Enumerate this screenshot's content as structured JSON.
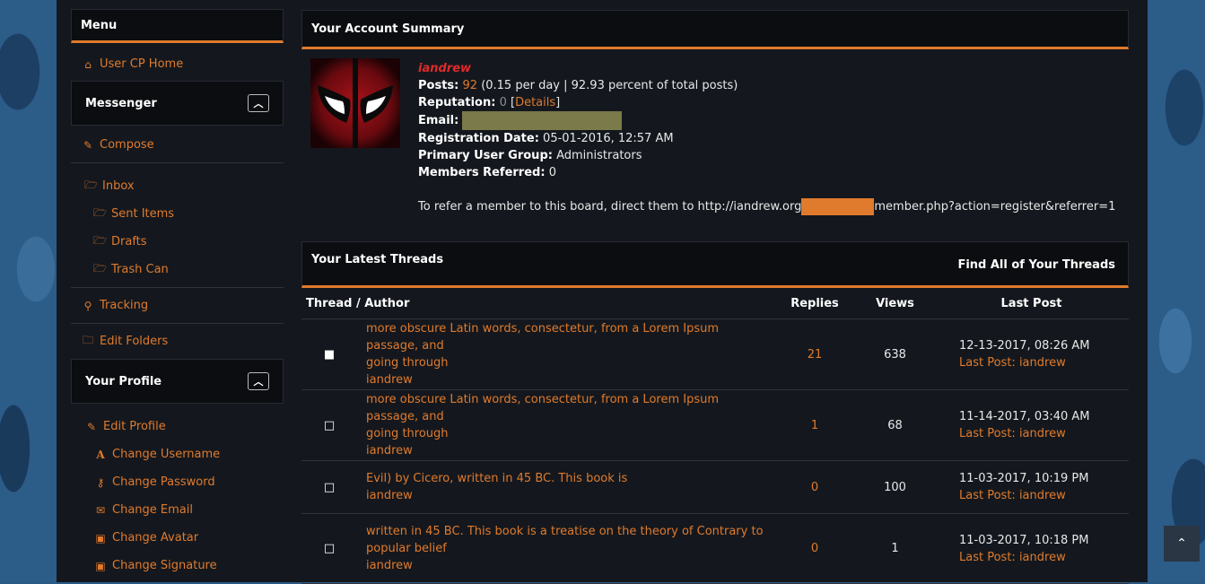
{
  "sidebar": {
    "menu_title": "Menu",
    "usercp_home": "User CP Home",
    "messenger": {
      "title": "Messenger",
      "compose": "Compose",
      "inbox": "Inbox",
      "sent": "Sent Items",
      "drafts": "Drafts",
      "trash": "Trash Can",
      "tracking": "Tracking",
      "edit_folders": "Edit Folders"
    },
    "profile": {
      "title": "Your Profile",
      "edit_profile": "Edit Profile",
      "change_username": "Change Username",
      "change_password": "Change Password",
      "change_email": "Change Email",
      "change_avatar": "Change Avatar",
      "change_signature": "Change Signature"
    }
  },
  "summary": {
    "title": "Your Account Summary",
    "username": "iandrew",
    "posts_label": "Posts:",
    "posts_value": "92",
    "posts_detail": "(0.15 per day | 92.93 percent of total posts)",
    "reputation_label": "Reputation:",
    "reputation_value": "0",
    "details_link": "Details",
    "email_label": "Email:",
    "regdate_label": "Registration Date:",
    "regdate_value": "05-01-2016, 12:57 AM",
    "group_label": "Primary User Group:",
    "group_value": "Administrators",
    "referred_label": "Members Referred:",
    "referred_value": "0",
    "refer_text_1": "To refer a member to this board, direct them to http://iandrew.org",
    "refer_text_2": "member.php?action=register&referrer=1"
  },
  "threads": {
    "title": "Your Latest Threads",
    "find_all": "Find All of Your Threads",
    "columns": {
      "thread": "Thread / Author",
      "replies": "Replies",
      "views": "Views",
      "last": "Last Post"
    },
    "last_post_label": "Last Post:",
    "rows": [
      {
        "line1": "more obscure Latin words, consectetur, from a Lorem Ipsum passage, and",
        "line2": "going through",
        "author": "iandrew",
        "replies": "21",
        "views": "638",
        "date": "12-13-2017, 08:26 AM",
        "last_user": "iandrew"
      },
      {
        "line1": "more obscure Latin words, consectetur, from a Lorem Ipsum passage, and",
        "line2": "going through",
        "author": "iandrew",
        "replies": "1",
        "views": "68",
        "date": "11-14-2017, 03:40 AM",
        "last_user": "iandrew"
      },
      {
        "line1": "Evil) by Cicero, written in 45 BC. This book is",
        "line2": "",
        "author": "iandrew",
        "replies": "0",
        "views": "100",
        "date": "11-03-2017, 10:19 PM",
        "last_user": "iandrew"
      },
      {
        "line1": "written in 45 BC. This book is a treatise on the theory of Contrary to",
        "line2": "popular belief",
        "author": "iandrew",
        "replies": "0",
        "views": "1",
        "date": "11-03-2017, 10:18 PM",
        "last_user": "iandrew"
      }
    ]
  },
  "colors": {
    "accent": "#e07a2c",
    "panel": "#0b0d10",
    "content_bg": "#14181e",
    "username": "#e02a2a"
  },
  "icons": [
    "home-icon",
    "pencil-icon",
    "folder-open-icon",
    "map-marker-icon",
    "folder-icon",
    "edit-icon",
    "font-icon",
    "key-icon",
    "envelope-icon",
    "image-icon",
    "chevron-up-icon",
    "double-chevron-up-icon"
  ]
}
